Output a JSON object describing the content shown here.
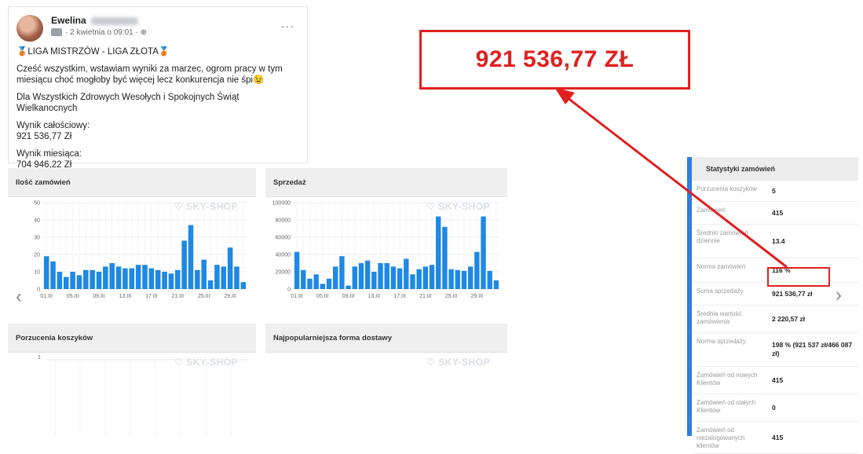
{
  "post": {
    "author": "Ewelina",
    "date": "· 2 kwietnia o 09:01 ·",
    "more": "···",
    "headline": "🥉LIGA MISTRZÓW - LIGA ZŁOTA🥉",
    "paragraph1": "Cześć wszystkim, wstawiam wyniki za marzec, ogrom pracy w tym miesiącu choć mogłoby być więcej lecz konkurencja nie śpi😉",
    "paragraph2": "Dla Wszystkich Zdrowych Wesołych i Spokojnych Świąt Wielkanocnych",
    "total_label": "Wynik całościowy:",
    "total_value": "921 536,77 Zł",
    "monthly_label": "Wynik miesiąca:",
    "monthly_value": "704 946,22 Zł"
  },
  "callout": {
    "text": "921 536,77 ZŁ",
    "color": "#e02020"
  },
  "dashboard": {
    "watermark": "SKY-SHOP",
    "panels": {
      "orders_title": "Ilość zamówień",
      "sales_title": "Sprzedaż",
      "abandoned_title": "Porzucenia koszyków",
      "delivery_title": "Najpopularniejsza forma dostawy"
    }
  },
  "abandoned_chart": {
    "y_tick": "1"
  },
  "stats": {
    "title": "Statystyki zamówień",
    "accent": "#2f7de1",
    "rows": [
      {
        "label": "Porzucenia koszyków",
        "value": "5"
      },
      {
        "label": "Zamówień",
        "value": "415"
      },
      {
        "label": "Średnio zamówień dziennie",
        "value": "13.4"
      },
      {
        "label": "Norma zamówień",
        "value": "116 %"
      },
      {
        "label": "Suma sprzedaży",
        "value": "921 536,77 zł"
      },
      {
        "label": "Średnia wartość zamówienia",
        "value": "2 220,57 zł"
      },
      {
        "label": "Norma sprzedaży",
        "value": "198 % (921 537 zł/466 087 zł)"
      },
      {
        "label": "Zamówień od nowych Klientów",
        "value": "415"
      },
      {
        "label": "Zamówień od stałych Klientów",
        "value": "0"
      },
      {
        "label": "Zamówień od niezalogowanych klientów",
        "value": "415"
      }
    ]
  },
  "chart_data": [
    {
      "type": "bar",
      "title": "Ilość zamówień",
      "color": "#1e88e5",
      "ylim": [
        0,
        50
      ],
      "yticks": [
        0,
        10,
        20,
        30,
        40,
        50
      ],
      "xticks": [
        "01.III",
        "05.III",
        "09.III",
        "13.III",
        "17.III",
        "21.III",
        "25.III",
        "29.III"
      ],
      "values": [
        19,
        16,
        10,
        7,
        10,
        8,
        11,
        11,
        10,
        13,
        15,
        13,
        12,
        12,
        14,
        14,
        12,
        11,
        10,
        9,
        11,
        28,
        37,
        11,
        17,
        5,
        14,
        13,
        24,
        13,
        4
      ]
    },
    {
      "type": "bar",
      "title": "Sprzedaż",
      "color": "#1e88e5",
      "ylim": [
        0,
        100000
      ],
      "yticks": [
        0,
        20000,
        40000,
        60000,
        80000,
        100000
      ],
      "xticks": [
        "01.III",
        "05.III",
        "09.III",
        "13.III",
        "17.III",
        "21.III",
        "25.III",
        "29.III"
      ],
      "values": [
        43000,
        22000,
        12000,
        17000,
        6000,
        12000,
        26000,
        38000,
        4000,
        26000,
        30000,
        33000,
        20000,
        30000,
        30000,
        26000,
        24000,
        35000,
        17000,
        23000,
        26000,
        28000,
        84000,
        72000,
        23000,
        22000,
        21000,
        26000,
        43000,
        84000,
        21000,
        10000
      ]
    }
  ]
}
